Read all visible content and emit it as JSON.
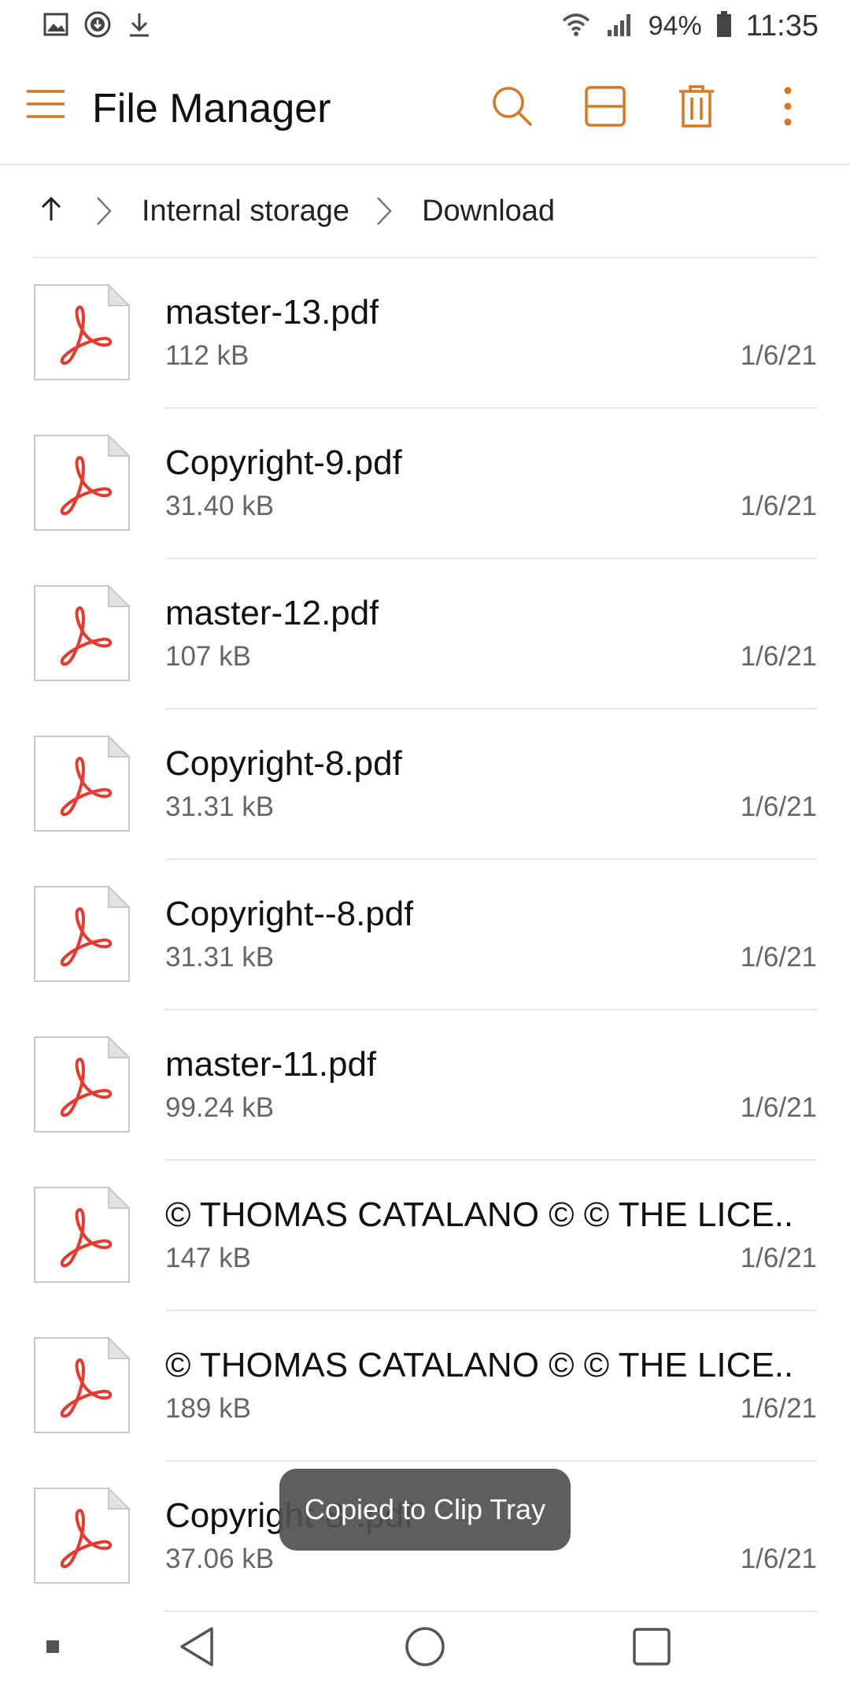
{
  "status_bar": {
    "battery": "94%",
    "time": "11:35",
    "icons": [
      "image-icon",
      "download-circle-icon",
      "download-icon",
      "wifi-icon",
      "signal-icon",
      "battery-icon"
    ]
  },
  "app_bar": {
    "title": "File Manager",
    "accent_color": "#d9771f",
    "actions": [
      "search-icon",
      "view-toggle-icon",
      "delete-icon",
      "more-options-icon"
    ]
  },
  "breadcrumb": {
    "items": [
      "Internal storage",
      "Download"
    ]
  },
  "files": [
    {
      "name": "master-13.pdf",
      "size": "112 kB",
      "date": "1/6/21"
    },
    {
      "name": "Copyright-9.pdf",
      "size": "31.40 kB",
      "date": "1/6/21"
    },
    {
      "name": "master-12.pdf",
      "size": "107 kB",
      "date": "1/6/21"
    },
    {
      "name": "Copyright-8.pdf",
      "size": "31.31 kB",
      "date": "1/6/21"
    },
    {
      "name": "Copyright--8.pdf",
      "size": "31.31 kB",
      "date": "1/6/21"
    },
    {
      "name": "master-11.pdf",
      "size": "99.24 kB",
      "date": "1/6/21"
    },
    {
      "name": "© THOMAS CATALANO © © THE LICE..",
      "size": "147 kB",
      "date": "1/6/21"
    },
    {
      "name": "© THOMAS CATALANO © © THE LICE..",
      "size": "189 kB",
      "date": "1/6/21"
    },
    {
      "name": "Copyright-8-.pdf",
      "size": "37.06 kB",
      "date": "1/6/21"
    }
  ],
  "toast": {
    "message": "Copied to Clip Tray"
  }
}
